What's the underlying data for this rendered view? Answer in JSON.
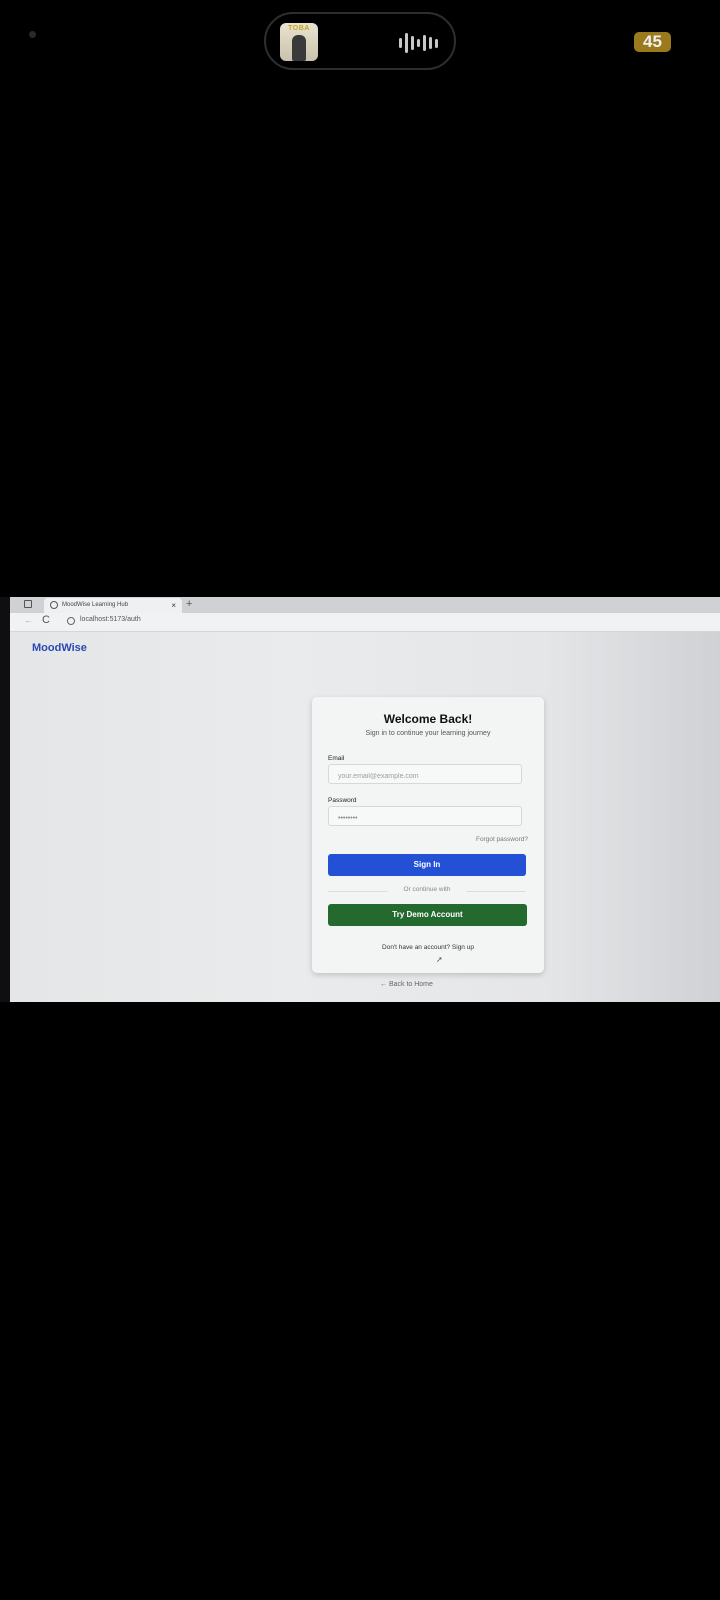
{
  "status": {
    "battery": "45",
    "media_thumb_text": "TOBA"
  },
  "browser": {
    "tab_title": "MoodWise Learning Hub",
    "tab_close": "×",
    "new_tab": "+",
    "back": "←",
    "reload": "C",
    "url": "localhost:5173/auth"
  },
  "page": {
    "brand": "MoodWise",
    "card": {
      "title": "Welcome Back!",
      "subtitle": "Sign in to continue your learning journey",
      "email_label": "Email",
      "email_placeholder": "your.email@example.com",
      "password_label": "Password",
      "password_value": "••••••••",
      "forgot_password": "Forgot password?",
      "sign_in": "Sign In",
      "divider": "Or continue with",
      "demo": "Try Demo Account",
      "signup": "Don't have an account? Sign up"
    },
    "back_home": "← Back to Home"
  },
  "colors": {
    "brand": "#2a48b4",
    "primary": "#2450d6",
    "demo": "#246a2e"
  }
}
